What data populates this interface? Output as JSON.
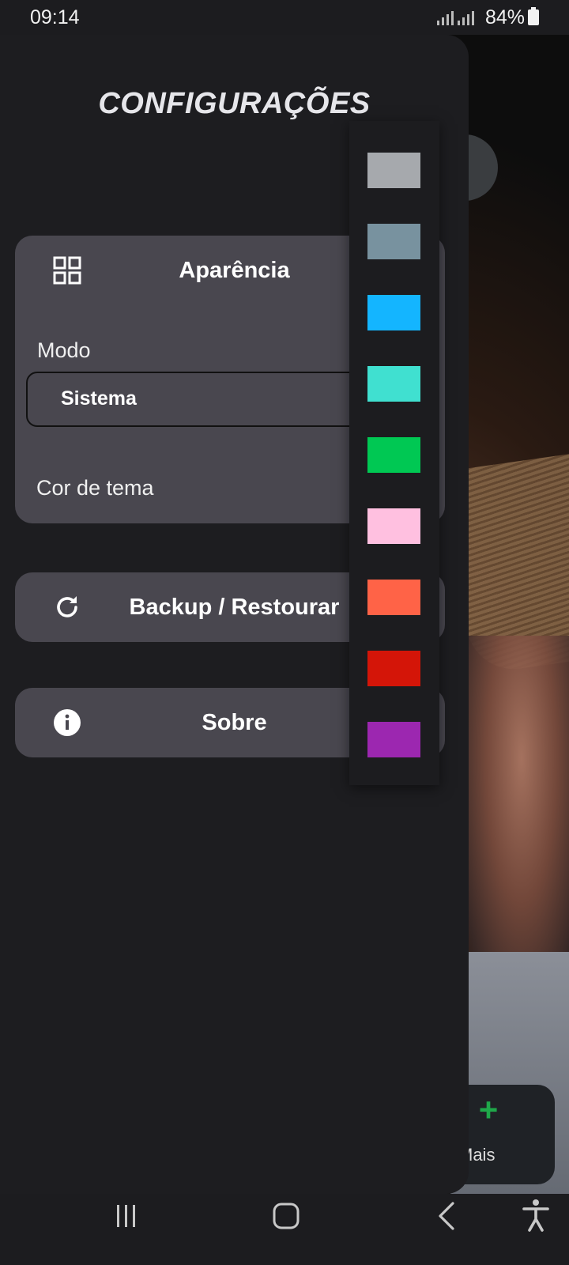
{
  "status_bar": {
    "time": "09:14",
    "battery": "84%"
  },
  "drawer": {
    "title": "CONFIGURAÇÕES",
    "appearance": {
      "title": "Aparência",
      "icon": "grid-icon",
      "mode_label": "Modo",
      "mode_value": "Sistema",
      "theme_color_label": "Cor de tema"
    },
    "backup": {
      "title": "Backup / Restourar",
      "icon": "refresh-icon"
    },
    "about": {
      "title": "Sobre",
      "icon": "info-icon"
    }
  },
  "theme_colors": [
    "#a6a9ad",
    "#78929f",
    "#14b5ff",
    "#40e0d0",
    "#00c853",
    "#ffc0e0",
    "#ff6347",
    "#d41508",
    "#9c27b0"
  ],
  "background_app": {
    "fab_label": "Mais"
  },
  "nav_bar": {
    "icons": [
      "recents-icon",
      "home-icon",
      "back-icon",
      "accessibility-icon"
    ]
  }
}
